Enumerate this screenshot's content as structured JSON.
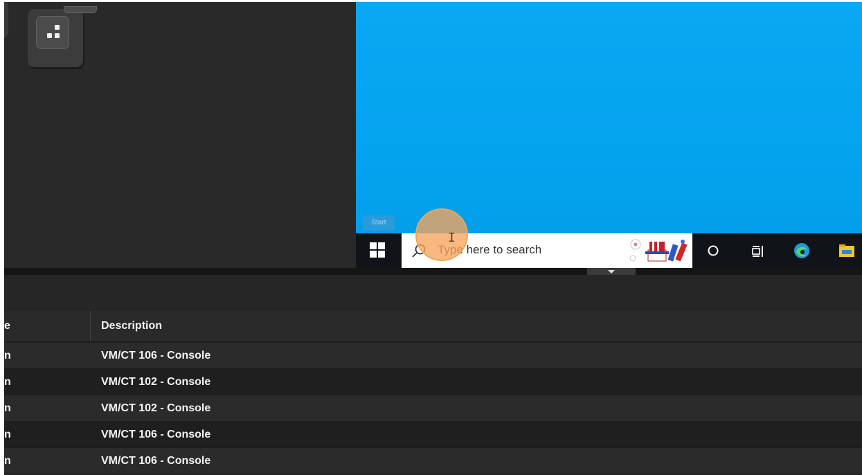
{
  "vm": {
    "start_tooltip": "Start",
    "search_placeholder": "Type here to search"
  },
  "table": {
    "columns": [
      "e",
      "Description"
    ],
    "rows": [
      {
        "col1": "n",
        "description": "VM/CT 106 - Console"
      },
      {
        "col1": "n",
        "description": "VM/CT 102 - Console"
      },
      {
        "col1": "n",
        "description": "VM/CT 102 - Console"
      },
      {
        "col1": "n",
        "description": "VM/CT 106 - Console"
      },
      {
        "col1": "n",
        "description": "VM/CT 106 - Console"
      }
    ]
  },
  "colors": {
    "desktop_blue": "#04a3ee",
    "taskbar": "#101418",
    "panel_dark": "#2a2a2a",
    "cursor_highlight": "#f7a45c"
  },
  "icons": [
    "windows-start-icon",
    "search-icon",
    "cortana-icon",
    "task-view-icon",
    "edge-icon",
    "file-explorer-icon",
    "collapse-arrow-icon"
  ]
}
